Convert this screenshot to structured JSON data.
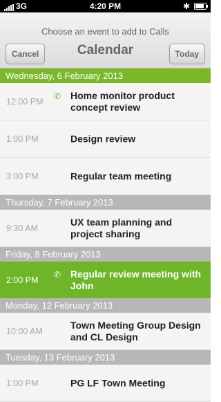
{
  "status_bar": {
    "carrier": "3G",
    "time": "4:20 PM"
  },
  "header": {
    "prompt": "Choose an event to add to Calls",
    "title": "Calendar",
    "cancel_label": "Cancel",
    "today_label": "Today"
  },
  "days": [
    {
      "label": "Wednesday, 6 February 2013"
    },
    {
      "label": "Thursday, 7 February 2013"
    },
    {
      "label": "Friday, 8 February 2013"
    },
    {
      "label": "Monday, 12 February 2013"
    },
    {
      "label": "Tuesday, 13 February 2013"
    }
  ],
  "events": [
    {
      "time": "12:00 PM",
      "title": "Home monitor product concept review"
    },
    {
      "time": "1:00 PM",
      "title": "Design review"
    },
    {
      "time": "3:00 PM",
      "title": "Regular team meeting"
    },
    {
      "time": "9:30 AM",
      "title": "UX team planning and project sharing"
    },
    {
      "time": "2:00 PM",
      "title": "Regular review meeting with John"
    },
    {
      "time": "10:00 AM",
      "title": "Town Meeting Group Design and CL Design"
    },
    {
      "time": "1:00 PM",
      "title": "PG LF Town Meeting"
    }
  ]
}
